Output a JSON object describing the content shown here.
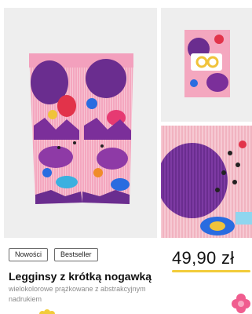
{
  "product": {
    "badges": [
      "Nowości",
      "Bestseller"
    ],
    "price": "49,90 zł",
    "title": "Legginsy z krótką nogawką",
    "description": "wielokolorowe prążkowane z abstrakcyjnym nadrukiem"
  },
  "images": [
    {
      "name": "product-photo-main",
      "description": "pink shorts with abstract print"
    },
    {
      "name": "product-photo-packaged",
      "description": "folded shorts with label"
    },
    {
      "name": "product-photo-fabric-closeup",
      "description": "ribbed fabric closeup"
    }
  ],
  "colors": {
    "price_underline": "#f2cc3a",
    "badge_border": "#6b6b6b",
    "accent_pink": "#e93b7c"
  }
}
